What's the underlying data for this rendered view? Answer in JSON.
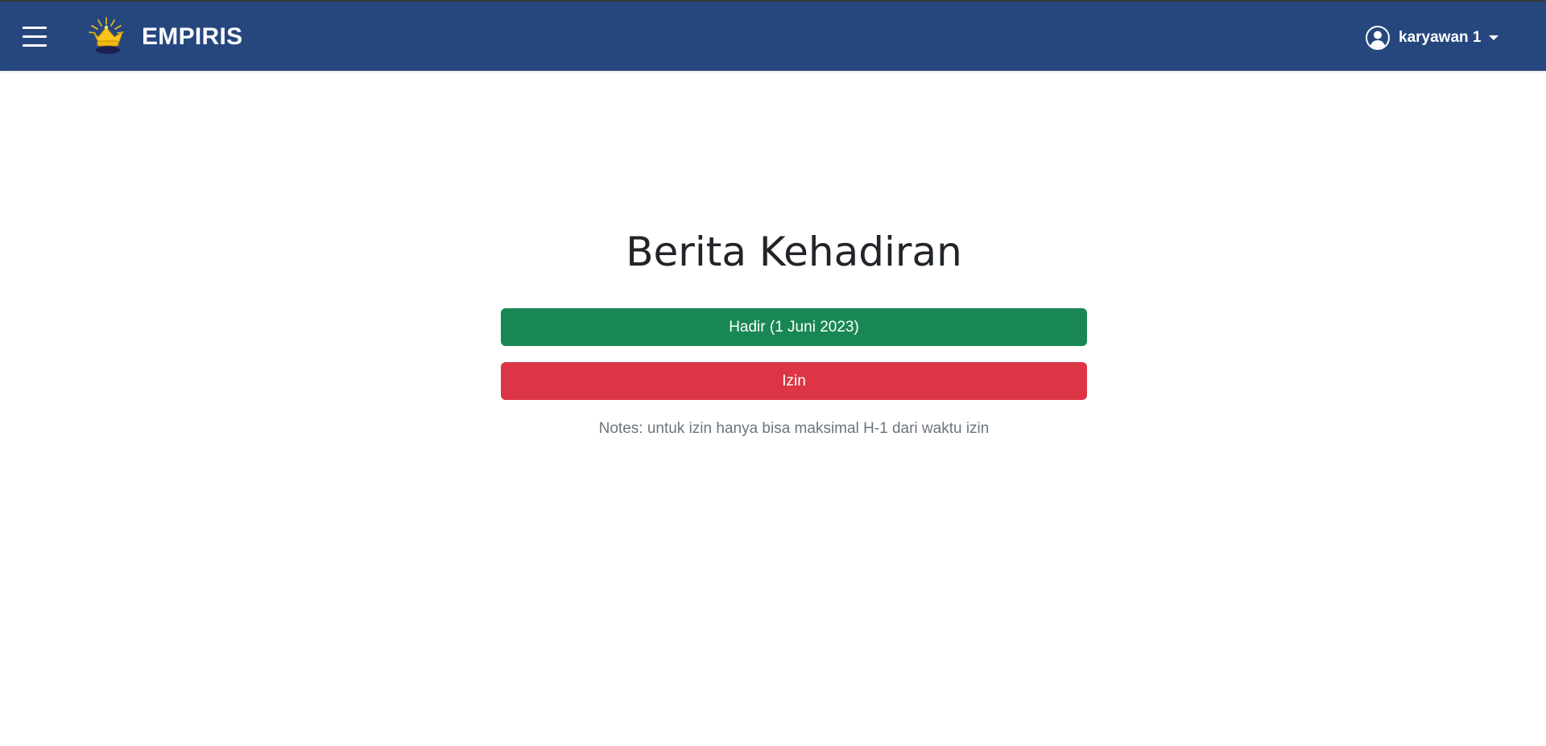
{
  "app": {
    "brand": "EMPIRIS",
    "colors": {
      "navbar": "#26477e",
      "success": "#198754",
      "danger": "#dc3545",
      "muted": "#6c757d",
      "heading": "#212529"
    }
  },
  "header": {
    "menu_icon": "hamburger-menu-icon",
    "logo_icon": "crown-logo",
    "user": {
      "icon": "user-circle-icon",
      "name": "karyawan 1",
      "caret_icon": "caret-down-icon"
    }
  },
  "main": {
    "title": "Berita Kehadiran",
    "buttons": {
      "hadir": "Hadir (1 Juni 2023)",
      "izin": "Izin"
    },
    "notes": "Notes: untuk izin hanya bisa maksimal H-1 dari waktu izin"
  }
}
